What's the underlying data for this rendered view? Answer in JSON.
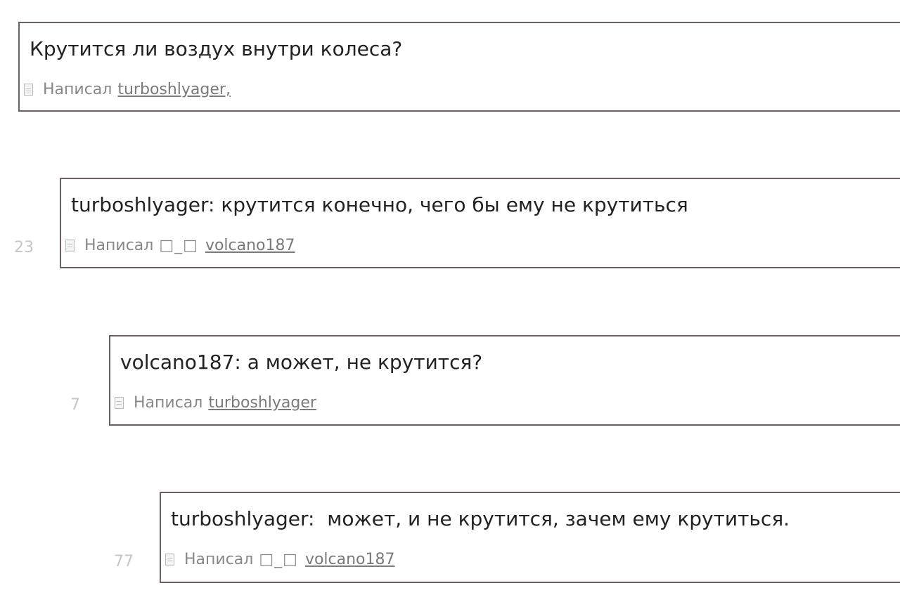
{
  "posts": [
    {
      "message": "Крутится ли воздух внутри колеса?",
      "written_label": "Написал",
      "author": "turboshlyager,"
    },
    {
      "message": "turboshlyager: крутится конечно, чего бы ему не крутиться",
      "count": "23",
      "written_label": "Написал",
      "squares": "□_□",
      "author": "volcano187"
    },
    {
      "message": "volcano187: а может, не крутится?",
      "count": "7",
      "written_label": "Написал",
      "author": "turboshlyager"
    },
    {
      "message": "turboshlyager:  может, и не крутится, зачем ему крутиться.",
      "count": "77",
      "written_label": "Написал",
      "squares": "□_□",
      "author": "volcano187"
    }
  ]
}
